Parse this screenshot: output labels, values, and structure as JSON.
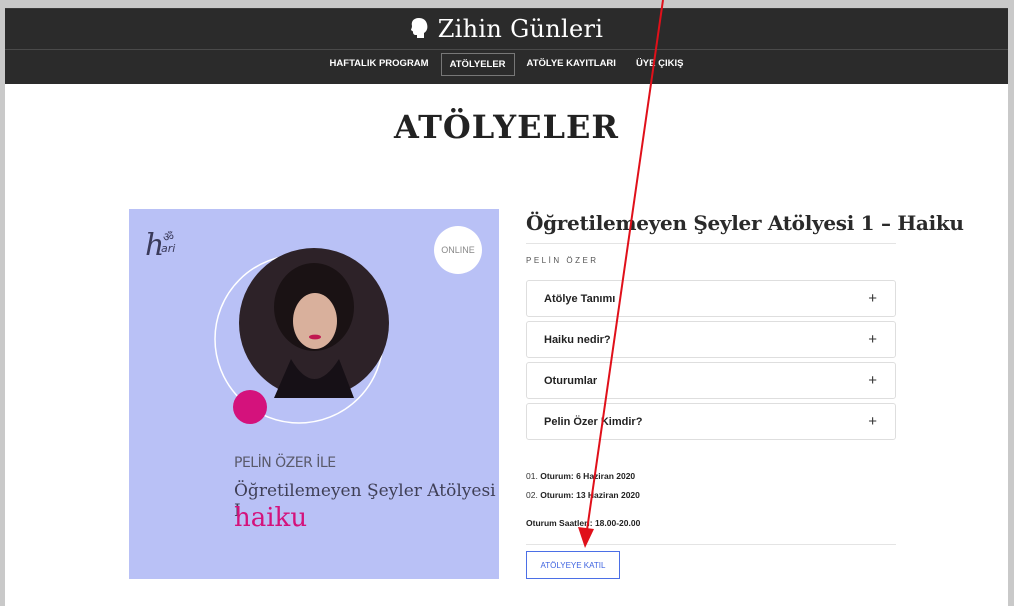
{
  "site": {
    "title": "Zihin Günleri"
  },
  "nav": {
    "items": [
      "HAFTALIK PROGRAM",
      "ATÖLYELER",
      "ATÖLYE KAYITLARI",
      "ÜYE ÇIKIŞ"
    ],
    "active_index": 1
  },
  "page_title": "ATÖLYELER",
  "poster": {
    "badge": "ONLINE",
    "ile": "PELİN ÖZER İLE",
    "subtitle": "Öğretilemeyen Şeyler Atölyesi I",
    "highlight": "haiku",
    "logo_text": "hari"
  },
  "workshop": {
    "title": "Öğretilemeyen Şeyler Atölyesi 1 – Haiku",
    "author": "PELİN ÖZER",
    "accordion": [
      {
        "label": "Atölye Tanımı",
        "toggle": "+"
      },
      {
        "label": "Haiku nedir?",
        "toggle": "+"
      },
      {
        "label": "Oturumlar",
        "toggle": "+"
      },
      {
        "label": "Pelin Özer Kimdir?",
        "toggle": "+"
      }
    ],
    "sessions": [
      {
        "num": "01.",
        "text": "Oturum: 6 Haziran 2020"
      },
      {
        "num": "02.",
        "text": "Oturum: 13 Haziran 2020"
      }
    ],
    "hours": "Oturum Saatleri: 18.00-20.00",
    "join_label": "ATÖLYEYE KATIL"
  },
  "colors": {
    "header_bg": "#2b2b2b",
    "poster_bg": "#b9c1f6",
    "accent_pink": "#d4127c",
    "button_blue": "#3e63e0",
    "annotation_red": "#e0101a"
  }
}
